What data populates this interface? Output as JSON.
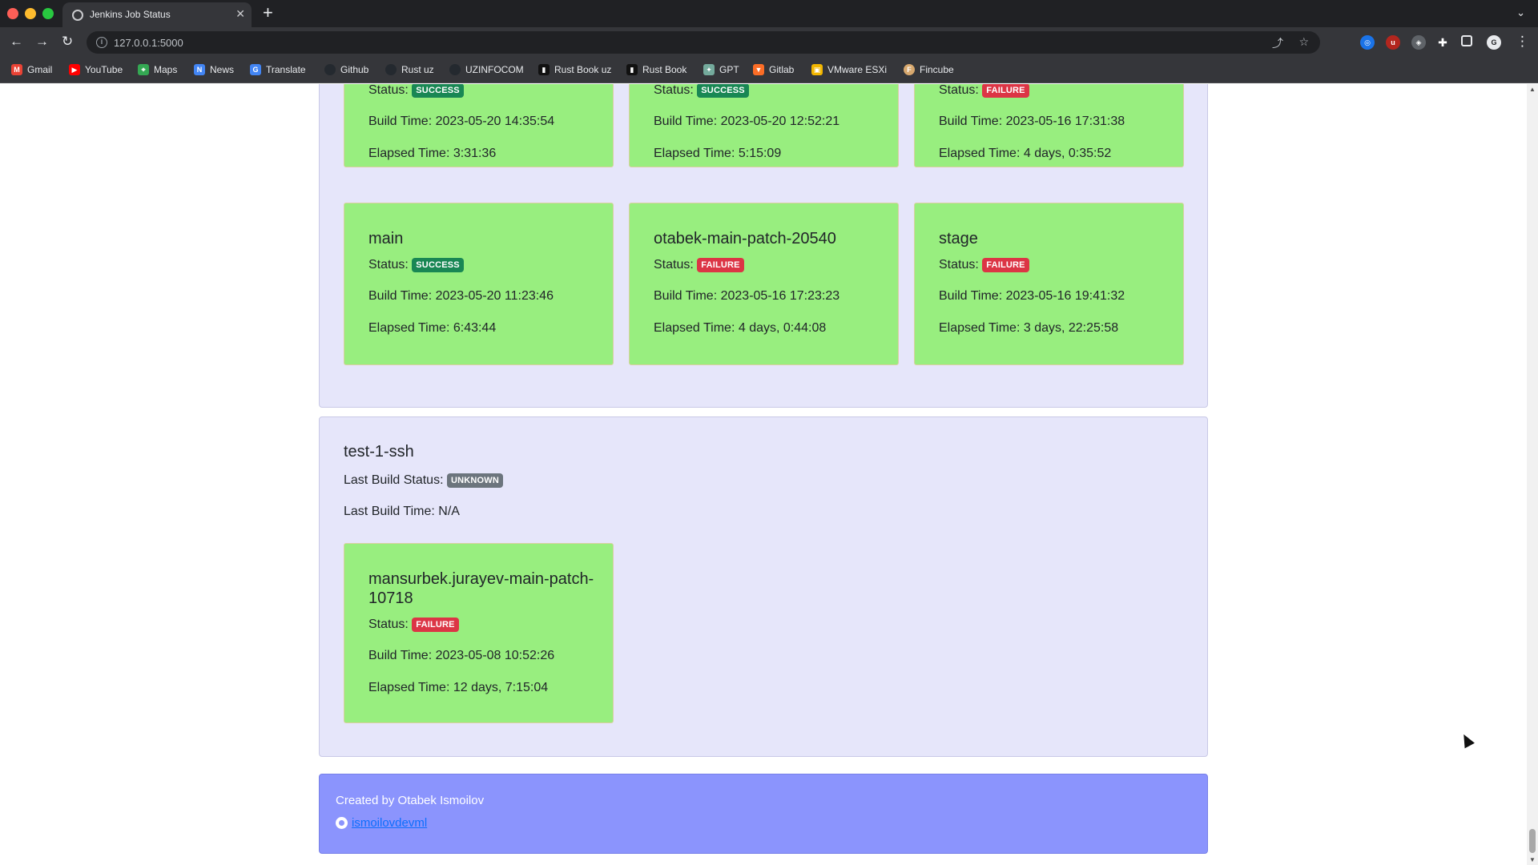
{
  "browser": {
    "tab_title": "Jenkins Job Status",
    "url": "127.0.0.1:5000",
    "bookmarks": [
      "Gmail",
      "YouTube",
      "Maps",
      "News",
      "Translate",
      "Github",
      "Rust uz",
      "UZINFOCOM",
      "Rust Book uz",
      "Rust Book",
      "GPT",
      "Gitlab",
      "VMware ESXi",
      "Fincube"
    ]
  },
  "labels": {
    "status": "Status:",
    "build_time": "Build Time:",
    "elapsed_time": "Elapsed Time:",
    "last_build_status": "Last Build Status:",
    "last_build_time": "Last Build Time:"
  },
  "group1": {
    "cards_top": [
      {
        "status": "SUCCESS",
        "build_time": "2023-05-20 14:35:54",
        "elapsed_time": "3:31:36"
      },
      {
        "status": "SUCCESS",
        "build_time": "2023-05-20 12:52:21",
        "elapsed_time": "5:15:09"
      },
      {
        "status": "FAILURE",
        "build_time": "2023-05-16 17:31:38",
        "elapsed_time": "4 days, 0:35:52"
      }
    ],
    "cards": [
      {
        "name": "main",
        "status": "SUCCESS",
        "build_time": "2023-05-20 11:23:46",
        "elapsed_time": "6:43:44"
      },
      {
        "name": "otabek-main-patch-20540",
        "status": "FAILURE",
        "build_time": "2023-05-16 17:23:23",
        "elapsed_time": "4 days, 0:44:08"
      },
      {
        "name": "stage",
        "status": "FAILURE",
        "build_time": "2023-05-16 19:41:32",
        "elapsed_time": "3 days, 22:25:58"
      }
    ]
  },
  "group2": {
    "job_name": "test-1-ssh",
    "last_build_status": "UNKNOWN",
    "last_build_time": "N/A",
    "cards": [
      {
        "name": "mansurbek.jurayev-main-patch-10718",
        "status": "FAILURE",
        "build_time": "2023-05-08 10:52:26",
        "elapsed_time": "12 days, 7:15:04"
      }
    ]
  },
  "footer": {
    "created_by": "Created by Otabek Ismoilov",
    "github_user": "ismoilovdevml"
  },
  "colors": {
    "card_bg": "#98ee7f",
    "group_bg": "#e6e6fa",
    "footer_bg": "#8b94fd",
    "success": "#198754",
    "failure": "#dc3545",
    "unknown": "#6c757d"
  }
}
